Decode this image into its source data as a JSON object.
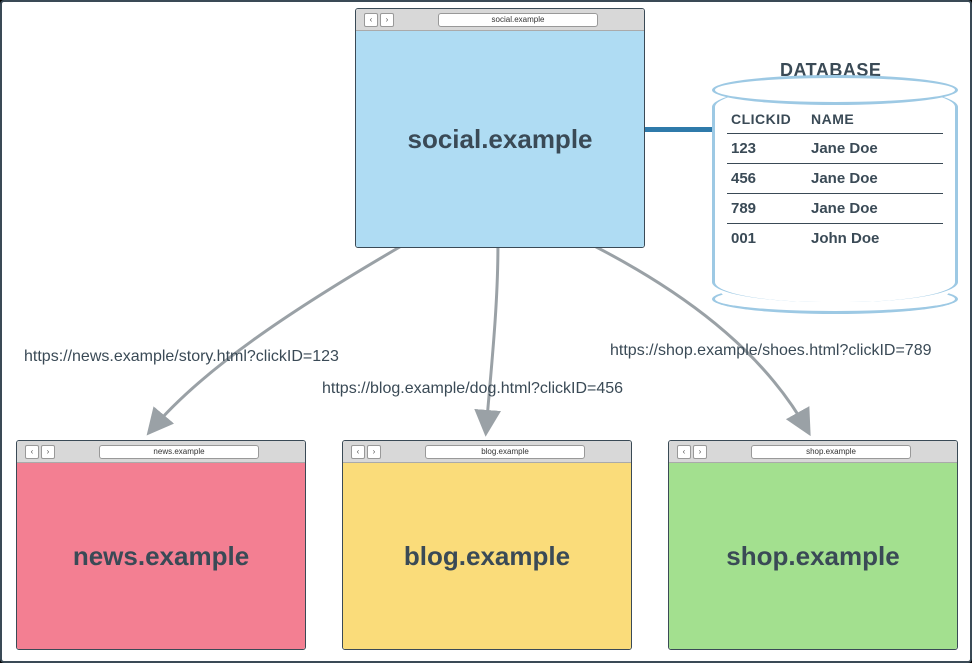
{
  "main_browser": {
    "url": "social.example",
    "title": "social.example"
  },
  "child_browsers": {
    "news": {
      "url": "news.example",
      "title": "news.example"
    },
    "blog": {
      "url": "blog.example",
      "title": "blog.example"
    },
    "shop": {
      "url": "shop.example",
      "title": "shop.example"
    }
  },
  "links": {
    "news": "https://news.example/story.html?clickID=123",
    "blog": "https://blog.example/dog.html?clickID=456",
    "shop": "https://shop.example/shoes.html?clickID=789"
  },
  "database": {
    "title": "DATABASE",
    "columns": {
      "id": "CLICKID",
      "name": "NAME"
    },
    "rows": [
      {
        "id": "123",
        "name": "Jane Doe"
      },
      {
        "id": "456",
        "name": "Jane Doe"
      },
      {
        "id": "789",
        "name": "Jane Doe"
      },
      {
        "id": "001",
        "name": "John Doe"
      }
    ]
  },
  "nav": {
    "back": "‹",
    "forward": "›"
  }
}
